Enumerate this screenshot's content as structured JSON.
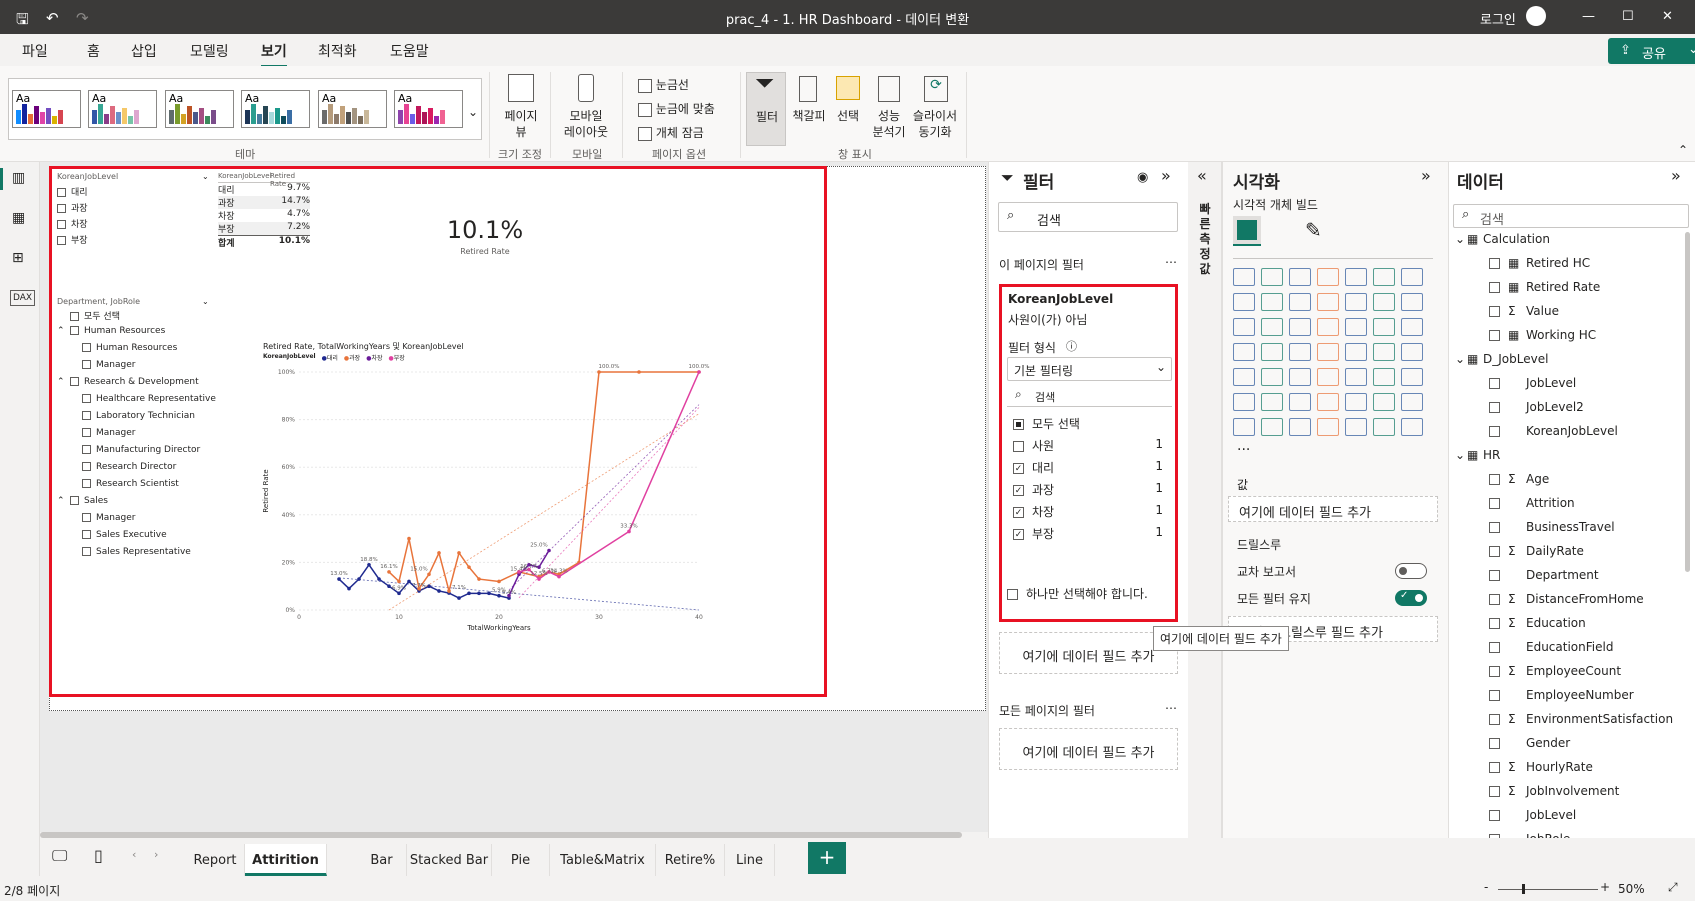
{
  "window": {
    "title": "prac_4 - 1. HR Dashboard - 데이터 변환",
    "login": "로그인"
  },
  "menu": {
    "items": [
      "파일",
      "홈",
      "삽입",
      "모델링",
      "보기",
      "최적화",
      "도움말"
    ],
    "active": "보기",
    "share": "공유"
  },
  "ribbon": {
    "theme_group": "테마",
    "page_view": [
      "페이지",
      "뷰"
    ],
    "size_group": "크기 조정",
    "mobile_layout": [
      "모바일",
      "레이아웃"
    ],
    "mobile_group": "모바일",
    "checks": [
      "눈금선",
      "눈금에 맞춤",
      "개체 잠금"
    ],
    "page_options_group": "페이지 옵션",
    "show_buttons": [
      {
        "l1": "필터",
        "l2": ""
      },
      {
        "l1": "책갈피",
        "l2": ""
      },
      {
        "l1": "선택",
        "l2": ""
      },
      {
        "l1": "성능",
        "l2": "분석기"
      },
      {
        "l1": "슬라이서",
        "l2": "동기화"
      }
    ],
    "show_group": "창 표시"
  },
  "slicer1": {
    "title": "KoreanJobLevel",
    "items": [
      "대리",
      "과장",
      "차장",
      "부장"
    ]
  },
  "table": {
    "headers": [
      "KoreanJobLevel",
      "Retired Rate"
    ],
    "rows": [
      [
        "대리",
        "9.7%"
      ],
      [
        "과장",
        "14.7%"
      ],
      [
        "차장",
        "4.7%"
      ],
      [
        "부장",
        "7.2%"
      ]
    ],
    "total": [
      "합계",
      "10.1%"
    ]
  },
  "card": {
    "value": "10.1%",
    "label": "Retired Rate"
  },
  "slicer2": {
    "title": "Department, JobRole",
    "select_all": "모두 선택",
    "groups": [
      {
        "name": "Human Resources",
        "items": [
          "Human Resources",
          "Manager"
        ]
      },
      {
        "name": "Research & Development",
        "items": [
          "Healthcare Representative",
          "Laboratory Technician",
          "Manager",
          "Manufacturing Director",
          "Research Director",
          "Research Scientist"
        ]
      },
      {
        "name": "Sales",
        "items": [
          "Manager",
          "Sales Executive",
          "Sales Representative"
        ]
      }
    ]
  },
  "chart_data": {
    "type": "line",
    "title": "Retired Rate, TotalWorkingYears 및 KoreanJobLevel",
    "legend_title": "KoreanJobLevel",
    "xlabel": "TotalWorkingYears",
    "ylabel": "Retired Rate",
    "xlim": [
      0,
      40
    ],
    "ylim": [
      0,
      1
    ],
    "xticks": [
      "0",
      "10",
      "20",
      "30",
      "40"
    ],
    "yticks": [
      "0%",
      "20%",
      "40%",
      "60%",
      "80%",
      "100%"
    ],
    "series": [
      {
        "name": "대리",
        "color": "#1f2a8f",
        "x": [
          4,
          5,
          6,
          7,
          8,
          9,
          10,
          11,
          12,
          13,
          14,
          15,
          16,
          17,
          18,
          19,
          20,
          21
        ],
        "y": [
          0.13,
          0.09,
          0.13,
          0.19,
          0.13,
          0.1,
          0.07,
          0.12,
          0.08,
          0.1,
          0.08,
          0.071,
          0.05,
          0.07,
          0.07,
          0.07,
          0.06,
          0.05
        ]
      },
      {
        "name": "과장",
        "color": "#e8743b",
        "x": [
          9,
          10,
          11,
          12,
          13,
          14,
          15,
          16,
          17,
          18,
          20,
          22,
          24,
          25,
          26,
          28,
          30,
          34,
          40
        ],
        "y": [
          0.16,
          0.12,
          0.3,
          0.09,
          0.15,
          0.24,
          0.08,
          0.24,
          0.18,
          0.13,
          0.12,
          0.16,
          0.14,
          0.16,
          0.15,
          0.2,
          1.0,
          1.0,
          1.0
        ]
      },
      {
        "name": "차장",
        "color": "#6a1b9a",
        "x": [
          21,
          22,
          23,
          24,
          25
        ],
        "y": [
          0.06,
          0.15,
          0.19,
          0.18,
          0.25
        ]
      },
      {
        "name": "부장",
        "color": "#e040a0",
        "x": [
          22,
          23,
          24,
          25,
          26,
          33,
          40
        ],
        "y": [
          0.16,
          0.17,
          0.13,
          0.16,
          0.14,
          0.33,
          1.0
        ]
      }
    ],
    "data_labels": [
      "13.0%",
      "18.8%",
      "16.1%",
      "15.0%",
      "6.9%",
      "7.7%",
      "7.1%",
      "5.9%",
      "5.4%",
      "15.4%",
      "16.7%",
      "25.0%",
      "14.3%",
      "12.5%",
      "6.7%",
      "100.0%",
      "100.0%",
      "33.3%"
    ]
  },
  "filters": {
    "title": "필터",
    "search": "검색",
    "this_page": "이 페이지의 필터",
    "card_title": "KoreanJobLevel",
    "card_sub": "사원이(가) 아님",
    "type_label": "필터 형식",
    "type_value": "기본 필터링",
    "inner_search": "검색",
    "select_all": "모두 선택",
    "items": [
      {
        "label": "사원",
        "count": "1",
        "checked": false
      },
      {
        "label": "대리",
        "count": "1",
        "checked": true
      },
      {
        "label": "과장",
        "count": "1",
        "checked": true
      },
      {
        "label": "차장",
        "count": "1",
        "checked": true
      },
      {
        "label": "부장",
        "count": "1",
        "checked": true
      }
    ],
    "single_select": "하나만 선택해야 합니다.",
    "add_field": "여기에 데이터 필드 추가",
    "all_pages": "모든 페이지의 필터",
    "tooltip": "여기에 데이터 필드 추가"
  },
  "side_tab": "빠른 측정값",
  "visualization": {
    "title": "시각화",
    "build": "시각적 개체 빌드",
    "values": "값",
    "add_field": "여기에 데이터 필드 추가",
    "drill": "드릴스루",
    "cross_report": "교차 보고서",
    "keep_filters": "모든 필터 유지",
    "add_drill": "여기에 드릴스루 필드 추가",
    "more": "..."
  },
  "data": {
    "title": "데이터",
    "search": "검색",
    "tables": [
      {
        "name": "Calculation",
        "fields": [
          {
            "n": "Retired HC",
            "t": "calc"
          },
          {
            "n": "Retired Rate",
            "t": "calc"
          },
          {
            "n": "Value",
            "t": "sum"
          },
          {
            "n": "Working HC",
            "t": "calc"
          }
        ]
      },
      {
        "name": "D_JobLevel",
        "fields": [
          {
            "n": "JobLevel",
            "t": ""
          },
          {
            "n": "JobLevel2",
            "t": ""
          },
          {
            "n": "KoreanJobLevel",
            "t": ""
          }
        ]
      },
      {
        "name": "HR",
        "fields": [
          {
            "n": "Age",
            "t": "sum"
          },
          {
            "n": "Attrition",
            "t": ""
          },
          {
            "n": "BusinessTravel",
            "t": ""
          },
          {
            "n": "DailyRate",
            "t": "sum"
          },
          {
            "n": "Department",
            "t": ""
          },
          {
            "n": "DistanceFromHome",
            "t": "sum"
          },
          {
            "n": "Education",
            "t": "sum"
          },
          {
            "n": "EducationField",
            "t": ""
          },
          {
            "n": "EmployeeCount",
            "t": "sum"
          },
          {
            "n": "EmployeeNumber",
            "t": ""
          },
          {
            "n": "EnvironmentSatisfaction",
            "t": "sum"
          },
          {
            "n": "Gender",
            "t": ""
          },
          {
            "n": "HourlyRate",
            "t": "sum"
          },
          {
            "n": "JobInvolvement",
            "t": "sum"
          },
          {
            "n": "JobLevel",
            "t": ""
          },
          {
            "n": "JobRole",
            "t": ""
          }
        ]
      }
    ]
  },
  "tabs": {
    "items": [
      "Report",
      "Attirition",
      "Bar",
      "Stacked Bar",
      "Pie",
      "Table&Matrix",
      "Retire%",
      "Line"
    ],
    "active": "Attirition",
    "add": "+"
  },
  "status": {
    "page": "2/8 페이지",
    "zoom": "50%"
  }
}
